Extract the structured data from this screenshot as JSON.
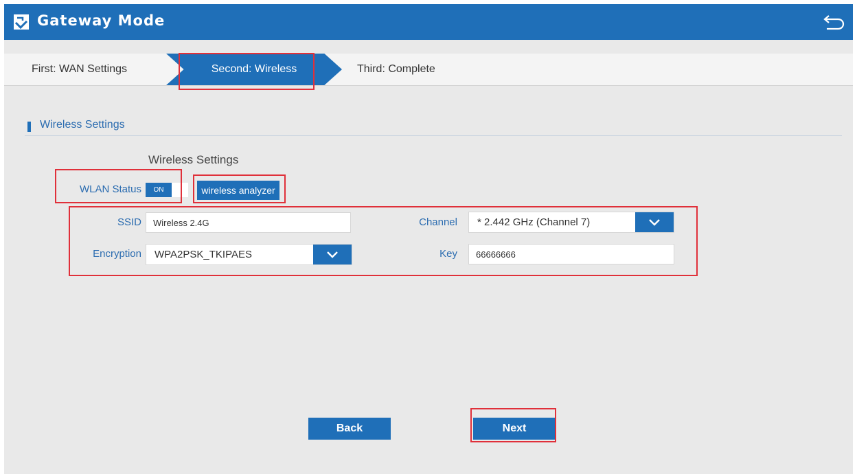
{
  "header": {
    "title": "Gateway Mode",
    "logo_icon": "router-icon",
    "back_icon": "return-arrow-icon"
  },
  "steps": [
    {
      "label": "First: WAN Settings",
      "active": false
    },
    {
      "label": "Second: Wireless",
      "active": true
    },
    {
      "label": "Third: Complete",
      "active": false
    }
  ],
  "section": {
    "title": "Wireless Settings",
    "subtitle": "Wireless Settings"
  },
  "wlan": {
    "label": "WLAN Status",
    "toggle_state": "ON",
    "analyzer_label": "wireless analyzer"
  },
  "form": {
    "ssid_label": "SSID",
    "ssid_value": "Wireless 2.4G",
    "channel_label": "Channel",
    "channel_value": "* 2.442 GHz (Channel 7)",
    "encryption_label": "Encryption",
    "encryption_value": "WPA2PSK_TKIPAES",
    "key_label": "Key",
    "key_value": "66666666"
  },
  "buttons": {
    "back": "Back",
    "next": "Next"
  },
  "colors": {
    "accent": "#1f6fb8",
    "annotation": "#e0303a",
    "background": "#e9e9e9"
  }
}
